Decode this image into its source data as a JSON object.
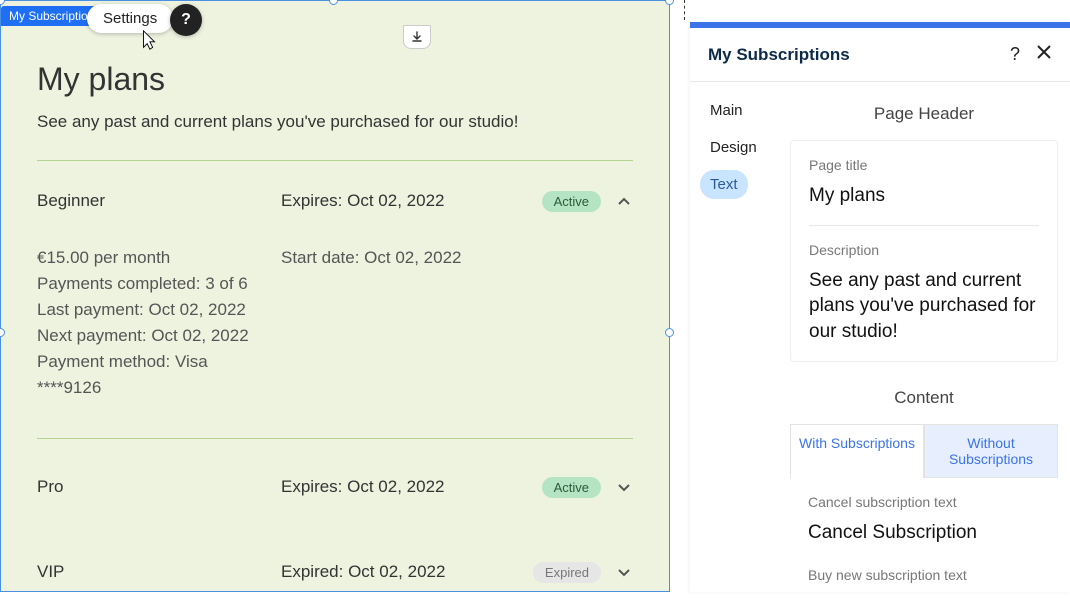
{
  "canvas": {
    "tag_label": "My Subscriptions",
    "settings_label": "Settings",
    "help_glyph": "?",
    "download_glyph": "⭳"
  },
  "preview": {
    "title": "My plans",
    "description": "See any past and current plans you've purchased for our studio!",
    "plans": [
      {
        "name": "Beginner",
        "expires": "Expires: Oct 02, 2022",
        "status": "Active",
        "expanded": true,
        "price": "€15.00 per month",
        "payments_completed": "Payments completed: 3 of 6",
        "last_payment": "Last payment: Oct 02, 2022",
        "next_payment": "Next payment: Oct 02, 2022",
        "payment_method": "Payment method: Visa",
        "card": "****9126",
        "start_date": "Start date: Oct 02, 2022"
      },
      {
        "name": "Pro",
        "expires": "Expires: Oct 02, 2022",
        "status": "Active",
        "expanded": false
      },
      {
        "name": "VIP",
        "expires": "Expired: Oct 02, 2022",
        "status": "Expired",
        "expanded": false
      }
    ]
  },
  "panel": {
    "title": "My Subscriptions",
    "help_glyph": "?",
    "tabs": {
      "main": "Main",
      "design": "Design",
      "text": "Text"
    },
    "page_header": {
      "section": "Page Header",
      "page_title_label": "Page title",
      "page_title_value": "My plans",
      "description_label": "Description",
      "description_value": "See any past and current plans you've purchased for our studio!"
    },
    "content": {
      "section": "Content",
      "tab_with": "With Subscriptions",
      "tab_without": "Without Subscriptions",
      "cancel_label": "Cancel subscription text",
      "cancel_value": "Cancel Subscription",
      "buy_label": "Buy new subscription text"
    }
  }
}
